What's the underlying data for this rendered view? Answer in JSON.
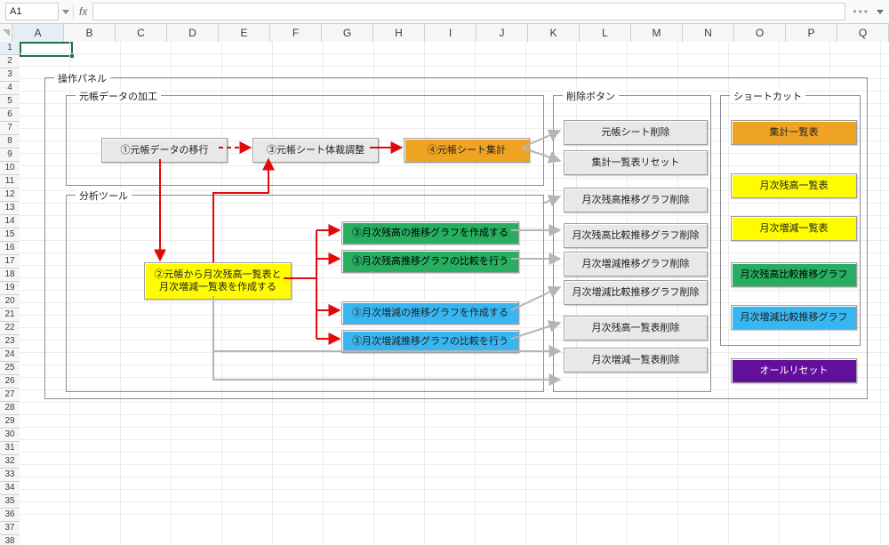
{
  "formula_bar": {
    "cell_ref": "A1",
    "fx_label": "fx",
    "formula_value": ""
  },
  "columns": [
    "A",
    "B",
    "C",
    "D",
    "E",
    "F",
    "G",
    "H",
    "I",
    "J",
    "K",
    "L",
    "M",
    "N",
    "O",
    "P",
    "Q"
  ],
  "row_count": 38,
  "panels": {
    "main": "操作パネル",
    "data": "元帳データの加工",
    "delete": "削除ボタン",
    "shortcut": "ショートカット",
    "analysis": "分析ツール"
  },
  "data_proc": {
    "step1": "①元帳データの移行",
    "step3": "③元帳シート体裁調整",
    "step4": "④元帳シート集計"
  },
  "analysis": {
    "core": "②元帳から月次残高一覧表と\n月次増減一覧表を作成する",
    "g1": "③月次残高の推移グラフを作成する",
    "g2": "③月次残高推移グラフの比較を行う",
    "g3": "③月次増減の推移グラフを作成する",
    "g4": "③月次増減推移グラフの比較を行う"
  },
  "delete_buttons": [
    "元帳シート削除",
    "集計一覧表リセット",
    "月次残高推移グラフ削除",
    "月次残高比較推移グラフ削除",
    "月次増減推移グラフ削除",
    "月次増減比較推移グラフ削除",
    "月次残高一覧表削除",
    "月次増減一覧表削除"
  ],
  "shortcut_buttons": [
    {
      "label": "集計一覧表",
      "color": "orange"
    },
    {
      "label": "月次残高一覧表",
      "color": "yellow"
    },
    {
      "label": "月次増減一覧表",
      "color": "yellow"
    },
    {
      "label": "月次残高比較推移グラフ",
      "color": "green"
    },
    {
      "label": "月次増減比較推移グラフ",
      "color": "sky"
    }
  ],
  "all_reset": "オールリセット"
}
